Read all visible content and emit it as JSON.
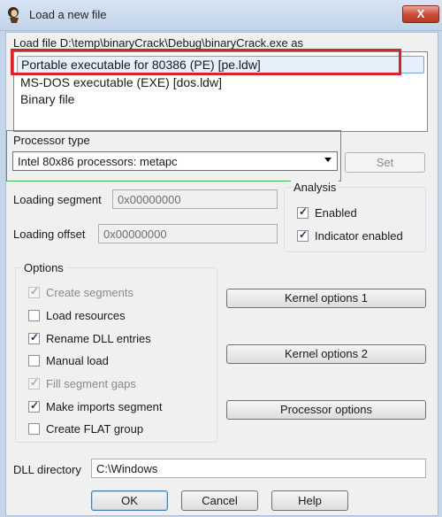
{
  "window": {
    "title": "Load a new file",
    "close_glyph": "X"
  },
  "load_file_label": "Load file D:\\temp\\binaryCrack\\Debug\\binaryCrack.exe as",
  "file_types": [
    "Portable executable for 80386 (PE) [pe.ldw]",
    "MS-DOS executable (EXE) [dos.ldw]",
    "Binary file"
  ],
  "processor": {
    "group_label": "Processor type",
    "selected": "Intel 80x86 processors: metapc",
    "set_button": "Set"
  },
  "loading_segment": {
    "label": "Loading segment",
    "value": "0x00000000"
  },
  "loading_offset": {
    "label": "Loading offset",
    "value": "0x00000000"
  },
  "analysis": {
    "title": "Analysis",
    "enabled": {
      "label": "Enabled",
      "checked": true
    },
    "indicator": {
      "label": "Indicator enabled",
      "checked": true
    }
  },
  "options": {
    "title": "Options",
    "items": [
      {
        "label": "Create segments",
        "checked": true,
        "disabled": true
      },
      {
        "label": "Load resources",
        "checked": false,
        "disabled": false
      },
      {
        "label": "Rename DLL entries",
        "checked": true,
        "disabled": false
      },
      {
        "label": "Manual load",
        "checked": false,
        "disabled": false
      },
      {
        "label": "Fill segment gaps",
        "checked": true,
        "disabled": true
      },
      {
        "label": "Make imports segment",
        "checked": true,
        "disabled": false
      },
      {
        "label": "Create FLAT group",
        "checked": false,
        "disabled": false
      }
    ]
  },
  "side_buttons": {
    "kernel1": "Kernel options 1",
    "kernel2": "Kernel options 2",
    "processor": "Processor options"
  },
  "dll_directory": {
    "label": "DLL directory",
    "value": "C:\\Windows"
  },
  "footer": {
    "ok": "OK",
    "cancel": "Cancel",
    "help": "Help"
  },
  "colors": {
    "highlight_red": "#d8232a",
    "highlight_green": "#3cae4a",
    "selection": "#e5f0fb"
  }
}
